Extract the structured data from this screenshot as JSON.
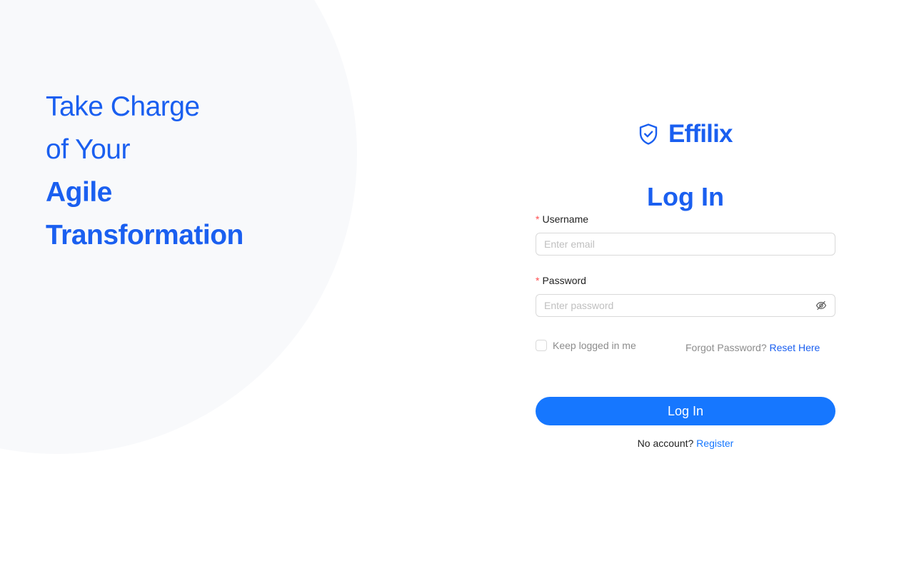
{
  "tagline": {
    "line1": "Take Charge",
    "line2": "of Your",
    "line3": "Agile",
    "line4": "Transformation"
  },
  "brand": {
    "name": "Effilix",
    "icon": "shield-check-icon"
  },
  "form": {
    "title": "Log In",
    "username": {
      "required_mark": "*",
      "label": "Username",
      "placeholder": "Enter email",
      "value": ""
    },
    "password": {
      "required_mark": "*",
      "label": "Password",
      "placeholder": "Enter password",
      "value": "",
      "toggle_icon": "eye-off-icon"
    },
    "remember": {
      "label": "Keep logged in me",
      "checked": false
    },
    "forgot": {
      "text": "Forgot Password?",
      "link": "Reset Here"
    },
    "submit_label": "Log In",
    "register": {
      "text": "No account?",
      "link": "Register"
    }
  },
  "colors": {
    "brand": "#1a5ff0",
    "button": "#1677ff",
    "required": "#ff4d4f",
    "background_shape": "#f8f9fb"
  }
}
